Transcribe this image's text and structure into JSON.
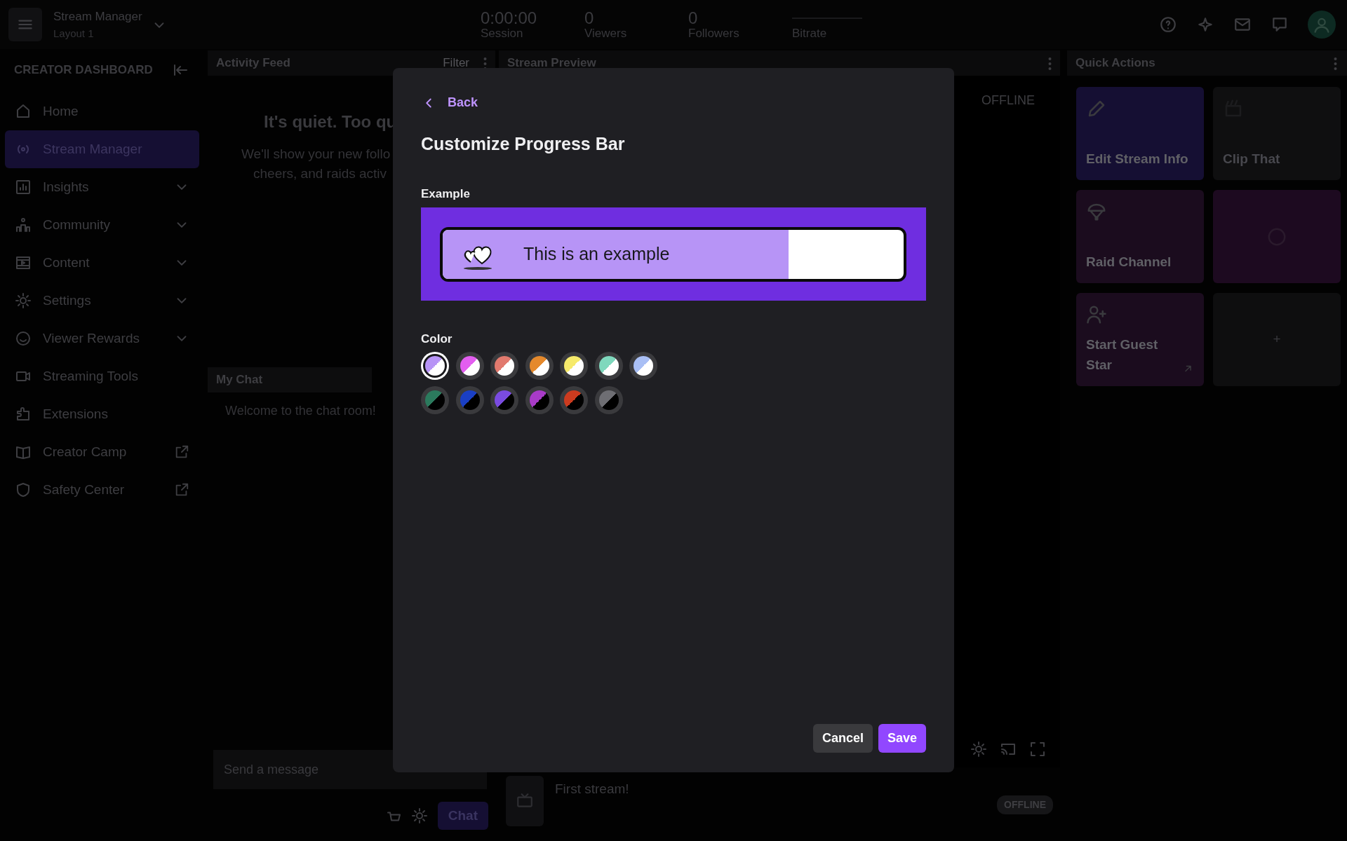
{
  "top_bar": {
    "title": "Stream Manager",
    "subtitle": "Layout 1",
    "stats": [
      {
        "kind": "number",
        "value": "0:00:00",
        "label": "Session"
      },
      {
        "kind": "number",
        "value": "0",
        "label": "Viewers"
      },
      {
        "kind": "number",
        "value": "0",
        "label": "Followers"
      },
      {
        "kind": "graph",
        "label": "Bitrate"
      }
    ]
  },
  "sidebar": {
    "title": "CREATOR DASHBOARD",
    "items": [
      {
        "label": "Home",
        "kind": "plain",
        "selected": false
      },
      {
        "label": "Stream Manager",
        "kind": "plain",
        "selected": true
      },
      {
        "label": "Insights",
        "kind": "expandable",
        "selected": false
      },
      {
        "label": "Community",
        "kind": "expandable",
        "selected": false
      },
      {
        "label": "Content",
        "kind": "expandable",
        "selected": false
      },
      {
        "label": "Settings",
        "kind": "expandable",
        "selected": false
      },
      {
        "label": "Viewer Rewards",
        "kind": "expandable",
        "selected": false
      },
      {
        "label": "Streaming Tools",
        "kind": "plain",
        "selected": false
      },
      {
        "label": "Extensions",
        "kind": "plain",
        "selected": false
      },
      {
        "label": "Creator Camp",
        "kind": "external",
        "selected": false
      },
      {
        "label": "Safety Center",
        "kind": "external",
        "selected": false
      }
    ]
  },
  "activity_feed": {
    "title": "Activity Feed",
    "filter": "Filter",
    "empty_title": "It's quiet. Too qu",
    "empty_lines": [
      "We'll show your new follo",
      "cheers, and raids activ"
    ]
  },
  "chat": {
    "title": "My Chat",
    "welcome": "Welcome to the chat room!",
    "placeholder": "Send a message",
    "button": "Chat"
  },
  "stream_preview": {
    "title": "Stream Preview",
    "status": "OFFLINE",
    "stream_title": "First stream!",
    "badge": "OFFLINE"
  },
  "quick_actions": {
    "title": "Quick Actions",
    "tiles": [
      {
        "kind": "action",
        "label": "Edit Stream Info",
        "color": "#150f33",
        "disabled": false
      },
      {
        "kind": "action",
        "label": "Clip That",
        "color": "#0f0f10",
        "disabled": true
      },
      {
        "kind": "action",
        "label": "Raid Channel",
        "color": "#1b0c1e",
        "disabled": false
      },
      {
        "kind": "loading",
        "color": "#1d0a20"
      },
      {
        "kind": "external",
        "label": "Start Guest Star",
        "color": "#1b0c1e",
        "disabled": false
      },
      {
        "kind": "add",
        "label": "+",
        "color": "#0e0e0f"
      }
    ]
  },
  "modal": {
    "back": "Back",
    "title": "Customize Progress Bar",
    "example_label": "Example",
    "example": {
      "text": "This is an example",
      "level": 0.75
    },
    "color_label": "Color",
    "swatches": [
      {
        "color": "#b794f6",
        "kind": "light",
        "selected": true
      },
      {
        "color": "#e35ef0",
        "kind": "light",
        "selected": false
      },
      {
        "color": "#e27a6e",
        "kind": "light",
        "selected": false
      },
      {
        "color": "#e5892c",
        "kind": "light",
        "selected": false
      },
      {
        "color": "#f6ea6b",
        "kind": "light",
        "selected": false
      },
      {
        "color": "#7fd8bd",
        "kind": "light",
        "selected": false
      },
      {
        "color": "#a9bff5",
        "kind": "light",
        "selected": false
      },
      {
        "color": "#2b7a5d",
        "kind": "dark",
        "selected": false
      },
      {
        "color": "#1a3fc4",
        "kind": "dark",
        "selected": false
      },
      {
        "color": "#7a4be0",
        "kind": "dark",
        "selected": false
      },
      {
        "color": "#a83bc7",
        "kind": "dark",
        "selected": false
      },
      {
        "color": "#cc3b1f",
        "kind": "dark",
        "selected": false
      },
      {
        "color": "#6e6e73",
        "kind": "dark",
        "selected": false
      }
    ],
    "buttons": [
      {
        "label": "Cancel",
        "kind": "secondary"
      },
      {
        "label": "Save",
        "kind": "primary"
      }
    ]
  }
}
